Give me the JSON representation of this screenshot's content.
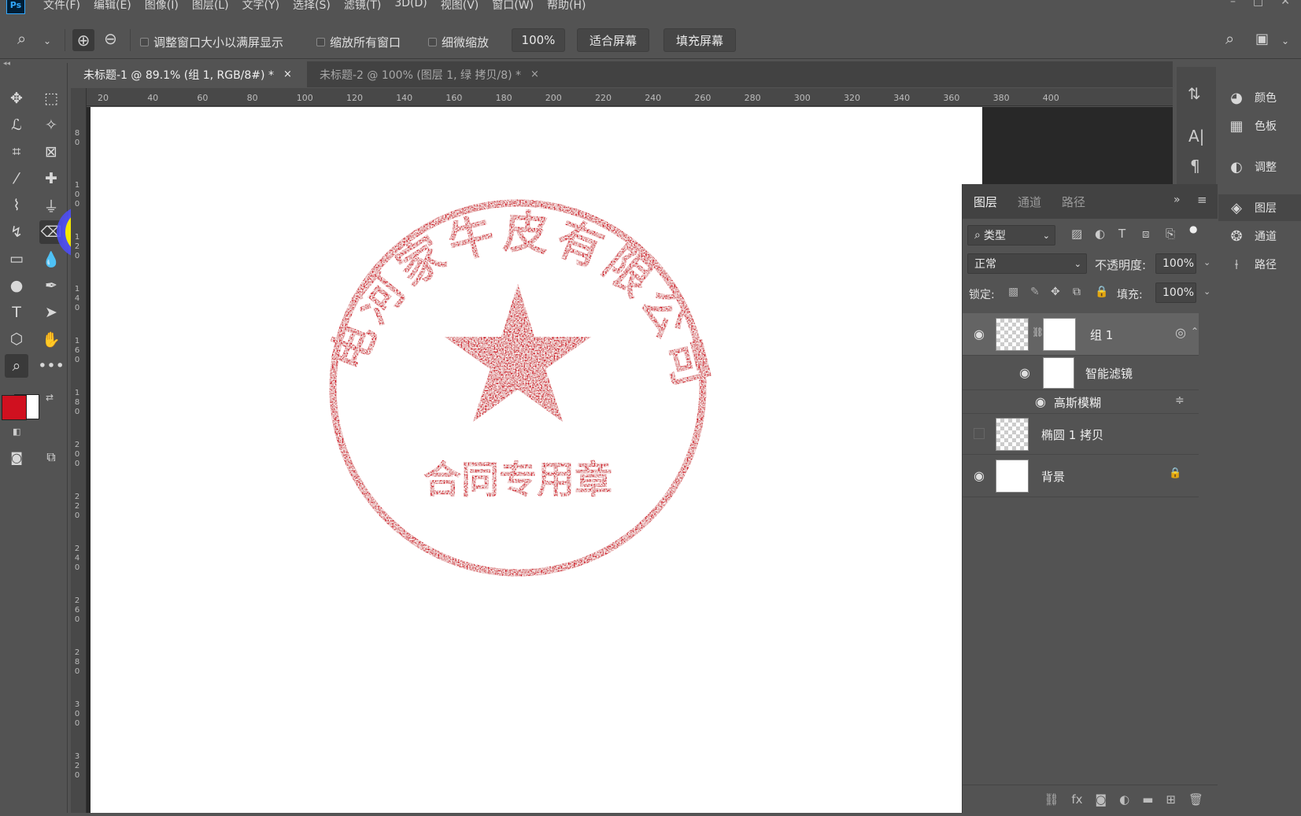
{
  "app": {
    "logo": "Ps"
  },
  "menu": [
    "文件(F)",
    "编辑(E)",
    "图像(I)",
    "图层(L)",
    "文字(Y)",
    "选择(S)",
    "滤镜(T)",
    "3D(D)",
    "视图(V)",
    "窗口(W)",
    "帮助(H)"
  ],
  "options": {
    "resize_windows": "调整窗口大小以满屏显示",
    "zoom_all": "缩放所有窗口",
    "scrubby_zoom": "细微缩放",
    "zoom_level": "100%",
    "fit_screen": "适合屏幕",
    "fill_screen": "填充屏幕"
  },
  "tabs": [
    {
      "label": "未标题-1 @ 89.1% (组 1, RGB/8#) *",
      "close": "×"
    },
    {
      "label": "未标题-2 @ 100% (图层 1, 绿 拷贝/8) *",
      "close": "×"
    }
  ],
  "ruler_top": [
    "20",
    "40",
    "60",
    "80",
    "100",
    "120",
    "140",
    "160",
    "180",
    "200",
    "220",
    "240",
    "260",
    "280",
    "300",
    "320",
    "340",
    "360",
    "380",
    "400"
  ],
  "ruler_left": [
    "8 0",
    "1 0 0",
    "1 2 0",
    "1 4 0",
    "1 6 0",
    "1 8 0",
    "2 0 0",
    "2 2 0",
    "2 4 0",
    "2 6 0",
    "2 8 0",
    "3 0 0",
    "3 2 0"
  ],
  "stamp": {
    "company": "电河家牛皮有限公司",
    "subtitle": "合同专用章",
    "color": "#d0101f"
  },
  "right_panels": [
    {
      "icon": "palette-icon",
      "label": "颜色"
    },
    {
      "icon": "grid-icon",
      "label": "色板"
    },
    {
      "icon": "adjust-icon",
      "label": "调整"
    },
    {
      "icon": "layers-icon",
      "label": "图层"
    },
    {
      "icon": "channels-icon",
      "label": "通道"
    },
    {
      "icon": "paths-icon",
      "label": "路径"
    }
  ],
  "layers_panel": {
    "tabs": [
      "图层",
      "通道",
      "路径"
    ],
    "filter_kind": "类型",
    "blend_mode": "正常",
    "opacity_label": "不透明度:",
    "opacity": "100%",
    "lock_label": "锁定:",
    "fill_label": "填充:",
    "fill": "100%",
    "layers": [
      {
        "name": "组 1"
      },
      {
        "name": "智能滤镜"
      },
      {
        "name": "高斯模糊"
      },
      {
        "name": "椭圆 1 拷贝"
      },
      {
        "name": "背景"
      }
    ]
  },
  "colors": {
    "foreground": "#d0101f",
    "background": "#ffffff"
  }
}
